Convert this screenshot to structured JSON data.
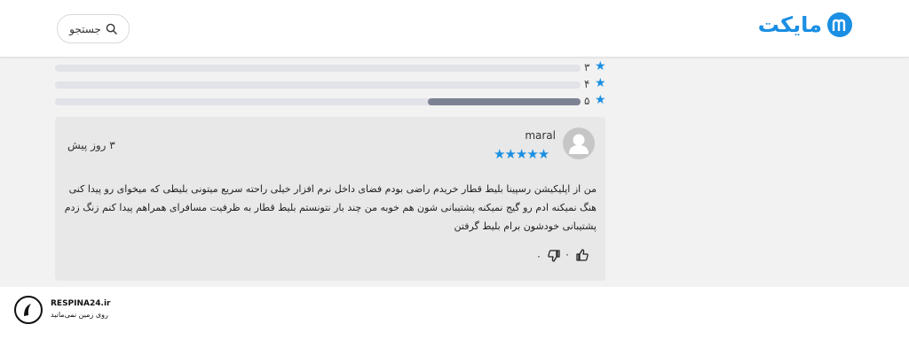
{
  "header": {
    "brand_name": "مایکت",
    "search_label": "جستجو"
  },
  "ratings": [
    {
      "label": "۳",
      "fraction": 0.0
    },
    {
      "label": "۴",
      "fraction": 0.0
    },
    {
      "label": "۵",
      "fraction": 0.29
    }
  ],
  "review": {
    "username": "maral",
    "stars": "★★★★★",
    "time_ago": "۳ روز پیش",
    "text": "من از اپلیکیشن رسپینا بلیط قطار خریدم راضی بودم فضای داخل نرم افزار خیلی راحته سریع میتونی بلیطی که میخوای رو پیدا کنی هنگ نمیکنه ادم رو گیج نمیکنه پشتیبانی شون هم خوبه من چند بار نتونستم بلیط قطار به ظرفیت مسافرای همراهم پیدا کنم زنگ زدم پشتیبانی خودشون برام بلیط گرفتن",
    "like_count": "۰",
    "dislike_count": "۰"
  },
  "footer": {
    "title": "RESPINA24.ir",
    "subtitle": "روی زمین نمی‌مانید"
  },
  "colors": {
    "accent": "#1a8fe3",
    "bar_fill": "#7d8293",
    "bar_track": "#e2e2e9",
    "card_bg": "#e8e8e8"
  }
}
